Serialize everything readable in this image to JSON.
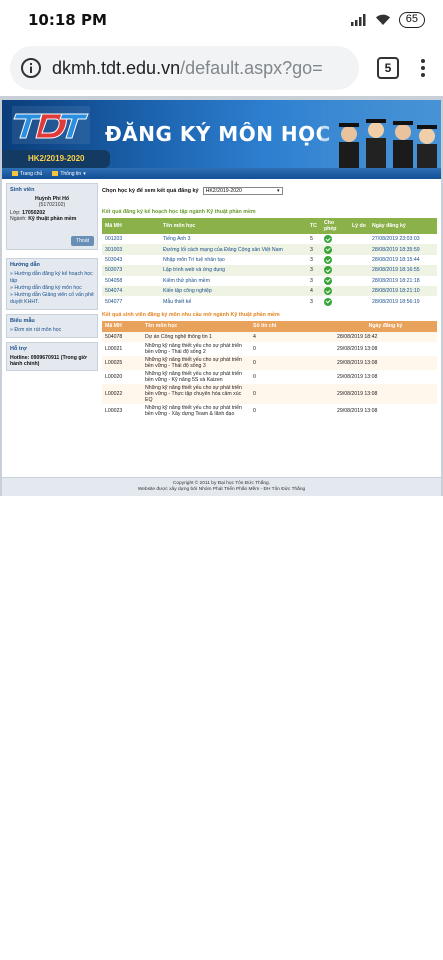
{
  "status": {
    "time": "10:18 PM",
    "battery": "65"
  },
  "browser": {
    "url_host": "dkmh.tdt.edu.vn",
    "url_path": "/default.aspx?go=",
    "tab_count": "5"
  },
  "banner": {
    "title": "ĐĂNG KÝ MÔN HỌC",
    "semester": "HK2/2019-2020"
  },
  "nav": {
    "home": "Trang chủ",
    "info": "Thông tin"
  },
  "sidebar": {
    "student": {
      "heading": "Sinh viên",
      "name": "Huỳnh Phi Hổ",
      "id": "(51702102)",
      "class_label": "Lớp:",
      "class_value": "17050202",
      "major_label": "Ngành:",
      "major_value": "Kỹ thuật phần mềm",
      "logout": "Thoát"
    },
    "guide": {
      "heading": "Hướng dẫn",
      "links": [
        "» Hướng dẫn đăng ký kế hoạch học tập",
        "» Hướng dẫn đăng ký môn học",
        "» Hướng dẫn Giảng viên cố vấn phê duyệt KHHT."
      ]
    },
    "forms": {
      "heading": "Biểu mẫu",
      "links": [
        "» Đơn xin rút môn học"
      ]
    },
    "support": {
      "heading": "Hỗ trợ",
      "hotline": "Hotline: 0909670911 (Trong giờ hành chính)"
    }
  },
  "main": {
    "semester_prompt": "Chọn học kỳ để xem kết quả đăng ký",
    "semester_selected": "HK2/2019-2020",
    "section1_title": "Kết quả đăng ký kế hoạch học tập ngành Kỹ thuật phần mềm",
    "table1": {
      "headers": [
        "Mã MH",
        "Tên môn học",
        "TC",
        "Cho phép",
        "Lý do",
        "Ngày đăng ký"
      ],
      "rows": [
        {
          "code": "001203",
          "name": "Tiếng Anh 3",
          "tc": "5",
          "date": "27/08/2019 23:03:03"
        },
        {
          "code": "301003",
          "name": "Đường lối cách mạng của Đảng Cộng sản Việt Nam",
          "tc": "3",
          "date": "28/08/2019 18:35:59"
        },
        {
          "code": "503043",
          "name": "Nhập môn Trí tuệ nhân tạo",
          "tc": "3",
          "date": "28/08/2019 18:15:44"
        },
        {
          "code": "503073",
          "name": "Lập trình web và ứng dụng",
          "tc": "3",
          "date": "28/08/2019 18:16:55"
        },
        {
          "code": "504058",
          "name": "Kiểm thử phần mềm",
          "tc": "3",
          "date": "28/08/2019 18:21:18"
        },
        {
          "code": "504074",
          "name": "Kiến tập công nghiệp",
          "tc": "4",
          "date": "28/08/2019 18:21:10"
        },
        {
          "code": "504077",
          "name": "Mẫu thiết kế",
          "tc": "3",
          "date": "28/08/2019 18:56:19"
        }
      ]
    },
    "section2_title": "Kết quả sinh viên đăng ký môn nhu cầu mở ngành Kỹ thuật phần mềm",
    "table2": {
      "headers": [
        "Mã MH",
        "Tên môn học",
        "Số tín chỉ",
        "Ngày đăng ký"
      ],
      "rows": [
        {
          "code": "504078",
          "name": "Dự án Công nghệ thông tin 1",
          "tc": "4",
          "date": "28/08/2019 18:42"
        },
        {
          "code": "L00021",
          "name": "Những kỹ năng thiết yếu cho sự phát triển bền vững - Thái độ sống 2",
          "tc": "0",
          "date": "29/08/2019 13:08"
        },
        {
          "code": "L00025",
          "name": "Những kỹ năng thiết yếu cho sự phát triển bền vững - Thái độ sống 3",
          "tc": "0",
          "date": "29/08/2019 13:08"
        },
        {
          "code": "L00020",
          "name": "Những kỹ năng thiết yếu cho sự phát triển bền vững - Kỹ năng 5S và Kaizen",
          "tc": "0",
          "date": "29/08/2019 13:08"
        },
        {
          "code": "L00022",
          "name": "Những kỹ năng thiết yếu cho sự phát triển bền vững - Thực tập chuyên hóa cảm xúc EQ",
          "tc": "0",
          "date": "29/08/2019 13:08"
        },
        {
          "code": "L00023",
          "name": "Những kỹ năng thiết yếu cho sự phát triển bền vững - Xây dựng Team & lãnh đạo",
          "tc": "0",
          "date": "29/08/2019 13:08"
        }
      ]
    }
  },
  "footer": {
    "line1": "Copyright © 2011 by Đại học Tôn Đức Thắng.",
    "line2": "Website được xây dựng bởi Nhóm Phát Triển Phần Mềm - ĐH Tôn Đức Thắng"
  }
}
